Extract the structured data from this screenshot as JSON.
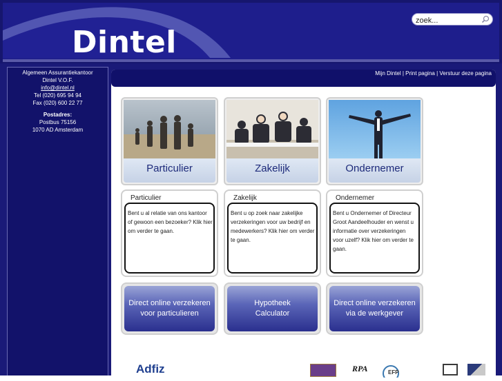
{
  "header": {
    "logo_text": "Dintel",
    "search_placeholder": "zoek..."
  },
  "sidebar": {
    "company_line1": "Algemeen Assurantiekantoor",
    "company_line2": "Dintel V.O.F.",
    "email": "info@dintel.nl",
    "tel": "Tel (020) 695 94 94",
    "fax": "Fax (020) 600 22 77",
    "postal_label": "Postadres:",
    "postal_line1": "Postbus 75156",
    "postal_line2": "1070 AD Amsterdam"
  },
  "toplinks": {
    "mijn": "Mijn Dintel",
    "print": "Print pagina",
    "verstuur": "Verstuur deze pagina",
    "sep": "|"
  },
  "tiles": [
    {
      "label": "Particulier"
    },
    {
      "label": "Zakelijk"
    },
    {
      "label": "Ondernemer"
    }
  ],
  "boxes": [
    {
      "title": "Particulier",
      "text": "Bent u al relatie van ons kantoor of gewoon een bezoeker? Klik hier om verder te gaan."
    },
    {
      "title": "Zakelijk",
      "text": "Bent u op zoek naar zakelijke verzekeringen voor uw bedrijf en medewerkers? Klik hier om verder te gaan."
    },
    {
      "title": "Ondernemer",
      "text": "Bent u Ondernemer of Directeur Groot Aandeelhouder en wenst u informatie over verzekeringen voor uzelf? Klik hier om verder te gaan."
    }
  ],
  "buttons": [
    {
      "line1": "Direct online verzekeren",
      "line2": "voor particulieren"
    },
    {
      "line1": "Hypotheek",
      "line2": "Calculator"
    },
    {
      "line1": "Direct online verzekeren",
      "line2": "via de werkgever"
    }
  ],
  "logos": {
    "adfiz": "Adfiz",
    "rpa": "RPA",
    "efp": "EFP"
  },
  "colors": {
    "header_bg": "#1e1e8c",
    "panel_bg": "#1a1a78",
    "button_dark": "#2a2f8e",
    "tile_text": "#1d2a7a"
  }
}
